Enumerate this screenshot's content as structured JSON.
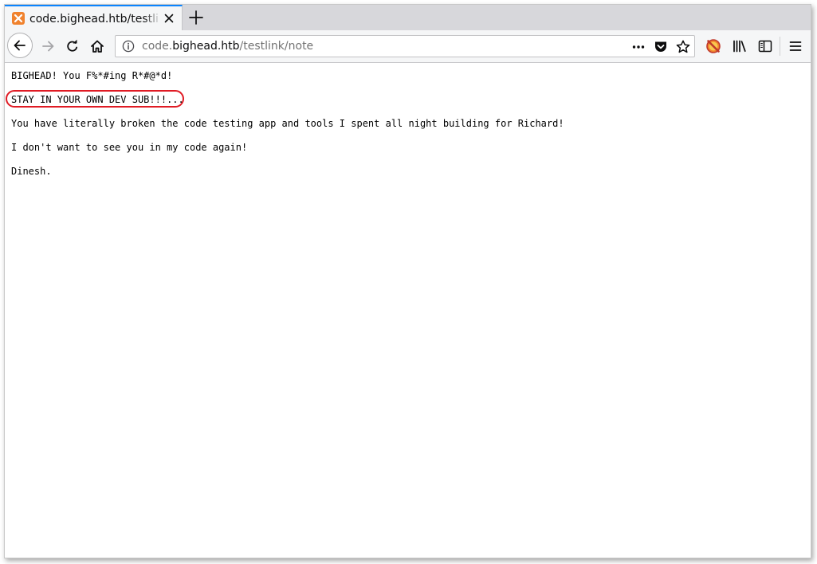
{
  "browser": {
    "tab": {
      "title": "code.bighead.htb/testlink/note",
      "favicon": "xampp-icon"
    },
    "new_tab_icon": "plus-icon",
    "nav": {
      "back_icon": "arrow-left-icon",
      "forward_icon": "arrow-right-icon",
      "reload_icon": "reload-icon",
      "home_icon": "home-icon"
    },
    "urlbar": {
      "info_icon": "info-icon",
      "prefix": "code.",
      "host": "bighead.htb",
      "path": "/testlink/note",
      "actions": [
        "more-dots-icon",
        "pocket-icon",
        "bookmark-star-icon"
      ]
    },
    "toolbar_icons": [
      "addon-icon",
      "library-icon",
      "sidebar-icon",
      "menu-icon"
    ]
  },
  "page": {
    "lines": [
      "BIGHEAD! You F%*#ing R*#@*d!",
      "STAY IN YOUR OWN DEV SUB!!!...",
      "You have literally broken the code testing app and tools I spent all night building for Richard!",
      "I don't want to see you in my code again!",
      "Dinesh."
    ],
    "highlight_color": "#e01b24"
  }
}
